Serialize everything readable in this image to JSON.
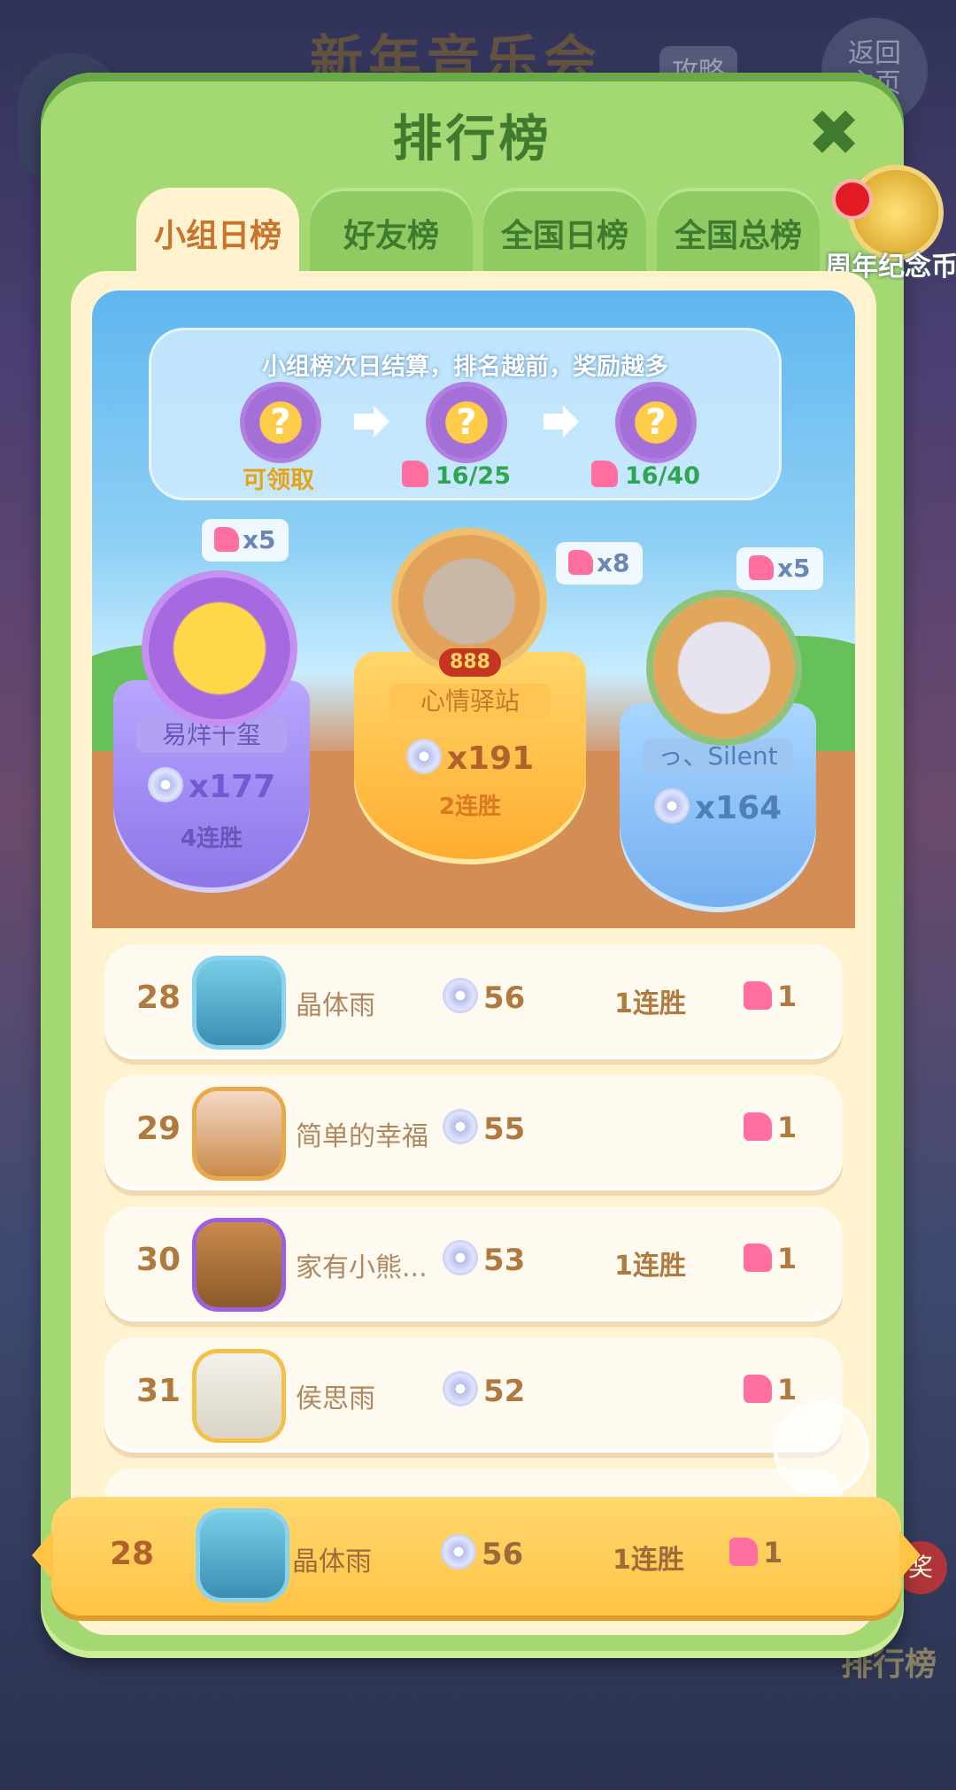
{
  "background": {
    "title": "新年音乐会",
    "guide_label": "攻略",
    "return_label": "返回\n主页",
    "badge": "奖",
    "bottom_label": "排行榜"
  },
  "panel": {
    "title": "排行榜",
    "close_icon": "close-icon"
  },
  "tabs": [
    {
      "label": "小组日榜",
      "active": true
    },
    {
      "label": "好友榜",
      "active": false
    },
    {
      "label": "全国日榜",
      "active": false
    },
    {
      "label": "全国总榜",
      "active": false
    }
  ],
  "anniversary_coin": {
    "label": "周年纪念币"
  },
  "notice": {
    "text": "小组榜次日结算，排名越前，奖励越多",
    "rewards": [
      {
        "icon": "?",
        "label": "可领取"
      },
      {
        "icon": "?",
        "progress": "16/25"
      },
      {
        "icon": "?",
        "progress": "16/40"
      }
    ]
  },
  "podium": {
    "first": {
      "name": "心情驿站",
      "score": "x191",
      "streak": "2连胜",
      "bubble": "x8",
      "frame_label": "888"
    },
    "second": {
      "name": "易烊千玺",
      "score": "x177",
      "streak": "4连胜",
      "bubble": "x5"
    },
    "third": {
      "name": "っ、Silent",
      "score": "x164",
      "bubble": "x5"
    }
  },
  "rows": [
    {
      "rank": "28",
      "name": "晶体雨",
      "score": "56",
      "streak": "1连胜",
      "pieces": "1"
    },
    {
      "rank": "29",
      "name": "简单的幸福",
      "score": "55",
      "streak": "",
      "pieces": "1"
    },
    {
      "rank": "30",
      "name": "家有小熊...",
      "score": "53",
      "streak": "1连胜",
      "pieces": "1"
    },
    {
      "rank": "31",
      "name": "侯思雨",
      "score": "52",
      "streak": "",
      "pieces": "1"
    }
  ],
  "my_row": {
    "rank": "28",
    "name": "晶体雨",
    "score": "56",
    "streak": "1连胜",
    "pieces": "1"
  },
  "colors": {
    "panel_green": "#a4d873",
    "tab_active_text": "#c9742c",
    "first_place": "#ffb43a",
    "second_place": "#9d86ee",
    "third_place": "#7fb7f0",
    "my_row": "#ffc445"
  }
}
